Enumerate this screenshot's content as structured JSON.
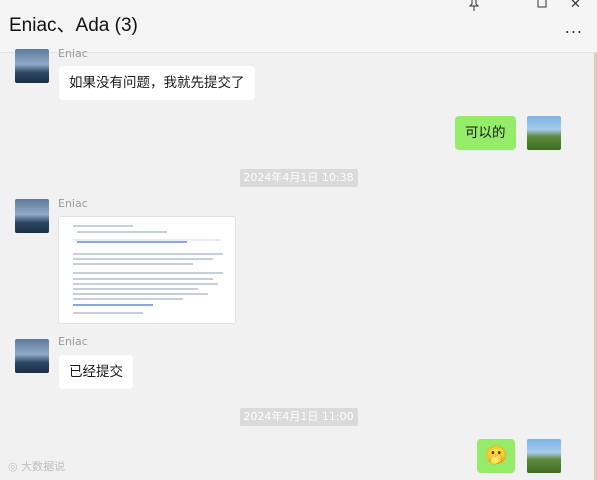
{
  "window": {
    "title": "Eniac、Ada (3)",
    "pin_icon": "pin-icon",
    "minimize_icon": "minimize-icon",
    "maximize_icon": "maximize-icon",
    "close_icon": "close-icon",
    "more_label": "..."
  },
  "messages": [
    {
      "id": "m1",
      "side": "left",
      "sender": "Eniac",
      "text": "如果没有问题，我就先提交了"
    },
    {
      "id": "m2",
      "side": "right",
      "text": "可以的"
    },
    {
      "id": "t1",
      "type": "time",
      "text": "2024年4月1日 10:38"
    },
    {
      "id": "m3",
      "side": "left",
      "sender": "Eniac",
      "type": "document-image"
    },
    {
      "id": "m4",
      "side": "left",
      "sender": "Eniac",
      "text": "已经提交"
    },
    {
      "id": "t2",
      "type": "time",
      "text": "2024年4月1日 11:00"
    },
    {
      "id": "m5",
      "side": "right",
      "type": "emoji",
      "emoji": "🫢"
    }
  ],
  "watermark": "大数据说",
  "colors": {
    "right_bubble": "#95ec69",
    "left_bubble": "#ffffff",
    "background": "#f1f1f1"
  }
}
